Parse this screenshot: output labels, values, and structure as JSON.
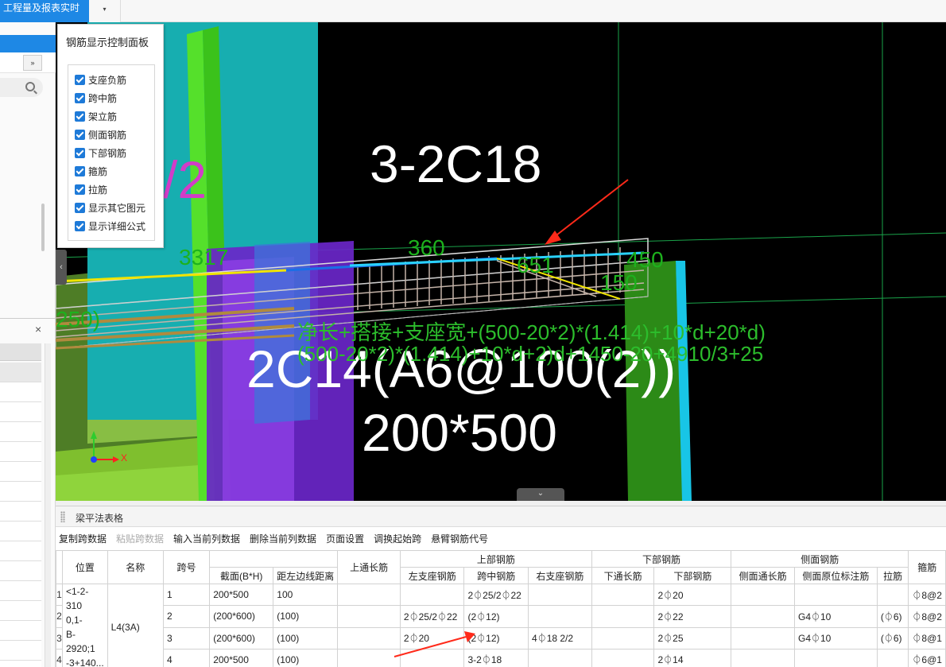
{
  "topbar": {
    "tab_label": "工程量及报表实时",
    "dropdown_icon": "▾"
  },
  "left_panel": {
    "expand_icon": "»",
    "close_icon": "×"
  },
  "control_panel": {
    "title": "钢筋显示控制面板",
    "items": [
      {
        "label": "支座负筋",
        "checked": true
      },
      {
        "label": "跨中筋",
        "checked": true
      },
      {
        "label": "架立筋",
        "checked": true
      },
      {
        "label": "侧面钢筋",
        "checked": true
      },
      {
        "label": "下部钢筋",
        "checked": true
      },
      {
        "label": "箍筋",
        "checked": true
      },
      {
        "label": "拉筋",
        "checked": true
      },
      {
        "label": "显示其它图元",
        "checked": true
      },
      {
        "label": "显示详细公式",
        "checked": true
      }
    ]
  },
  "viewport": {
    "label_span": "3-2C18",
    "label_stirrup": "2C14(A6@100(2))",
    "label_section": "200*500",
    "label_fraction": "/2",
    "label_3317": "3317",
    "label_360": "360",
    "label_651": "651",
    "label_450": "450",
    "label_150": "150",
    "label_250": "250)",
    "formula_1": "净长+搭接+支座宽+(500-20*2)*(1.414)+10*d+20*d)",
    "formula_2": "(500-20*2)*(1.414)+10*d+2)d+1450-20+4910/3+25",
    "axis_x": "X",
    "bottom_handle": "⌄",
    "collapse_tab": "‹"
  },
  "table_panel": {
    "title": "梁平法表格",
    "toolbar": [
      {
        "label": "复制跨数据",
        "disabled": false
      },
      {
        "label": "粘贴跨数据",
        "disabled": true
      },
      {
        "label": "输入当前列数据",
        "disabled": false
      },
      {
        "label": "删除当前列数据",
        "disabled": false
      },
      {
        "label": "页面设置",
        "disabled": false
      },
      {
        "label": "调换起始跨",
        "disabled": false
      },
      {
        "label": "悬臂钢筋代号",
        "disabled": false
      }
    ],
    "headers": {
      "position": "位置",
      "name": "名称",
      "span_no": "跨号",
      "top_through": "上通长筋",
      "top_group": "上部钢筋",
      "bottom_group": "下部钢筋",
      "side_group": "侧面钢筋",
      "stirrup": "箍筋",
      "section": "截面(B*H)",
      "edge_dist": "距左边线距离",
      "left_support": "左支座钢筋",
      "mid_span": "跨中钢筋",
      "right_support": "右支座钢筋",
      "bottom_through": "下通长筋",
      "bottom_bar": "下部钢筋",
      "side_through": "侧面通长筋",
      "side_orig": "侧面原位标注筋",
      "tie": "拉筋"
    },
    "position_value": "<1-2-3100,1-B-2920;1-3+140...",
    "position_lines": [
      "<1-2-310",
      "0,1-",
      "B-2920;1",
      "-3+140..."
    ],
    "name_value": "L4(3A)",
    "rows": [
      {
        "rn": "1",
        "span": "1",
        "section": "200*500",
        "edge": "100",
        "left": "",
        "mid": "2⏀25/2⏀22",
        "right": "",
        "bthrough": "",
        "bottom": "2⏀20",
        "sthrough": "",
        "sorig": "",
        "tie": "",
        "stirrup": "⏀8@2"
      },
      {
        "rn": "2",
        "span": "2",
        "section": "(200*600)",
        "edge": "(100)",
        "left": "2⏀25/2⏀22",
        "mid": "(2⏀12)",
        "right": "",
        "bthrough": "",
        "bottom": "2⏀22",
        "sthrough": "",
        "sorig": "G4⏀10",
        "tie": "(⏀6)",
        "stirrup": "⏀8@2"
      },
      {
        "rn": "3",
        "span": "3",
        "section": "(200*600)",
        "edge": "(100)",
        "left": "2⏀20",
        "mid": "(2⏀12)",
        "right": "4⏀18 2/2",
        "bthrough": "",
        "bottom": "2⏀25",
        "sthrough": "",
        "sorig": "G4⏀10",
        "tie": "(⏀6)",
        "stirrup": "⏀8@1"
      },
      {
        "rn": "4",
        "span": "4",
        "section": "200*500",
        "edge": "(100)",
        "left": "",
        "mid": "3-2⏀18",
        "right": "",
        "bthrough": "",
        "bottom": "2⏀14",
        "sthrough": "",
        "sorig": "",
        "tie": "",
        "stirrup": "⏀6@1"
      }
    ]
  },
  "colors": {
    "accent": "#1e88e5",
    "annotation_arrow": "#ff2a1a",
    "beam_green": "#3fd41f",
    "column_cyan": "#19b0b0",
    "purple": "#7a2bd6"
  }
}
